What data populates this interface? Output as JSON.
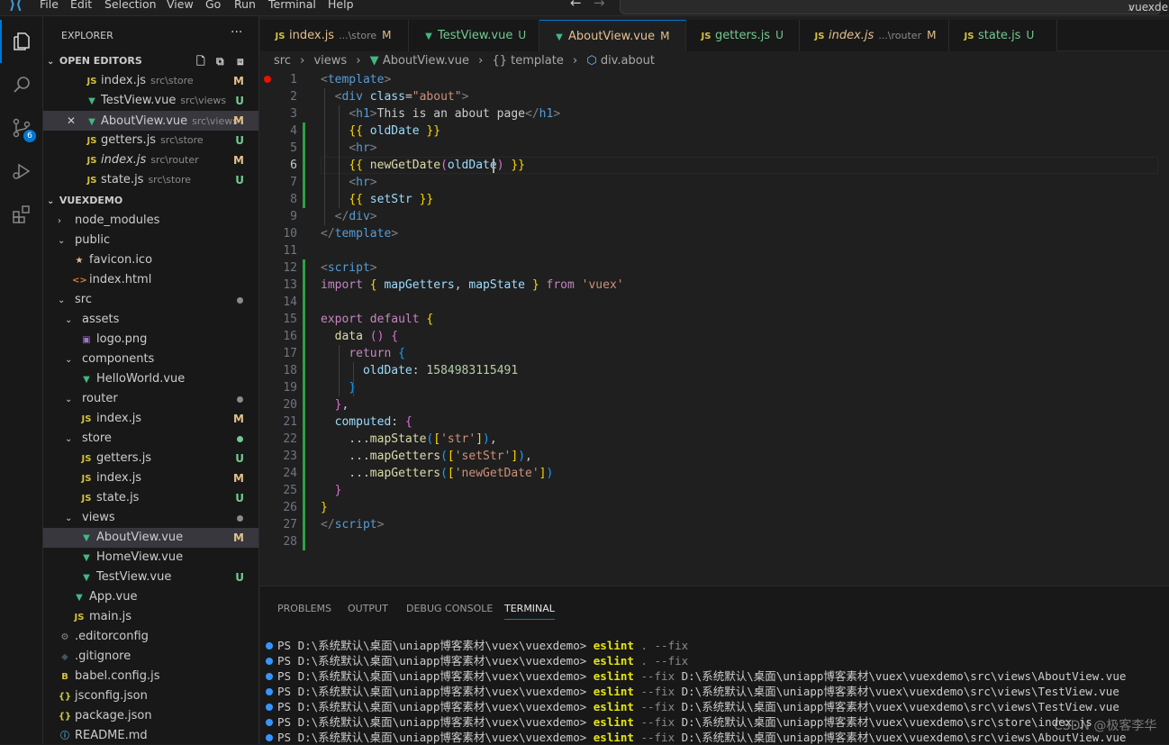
{
  "titlebar": {
    "menus": [
      "File",
      "Edit",
      "Selection",
      "View",
      "Go",
      "Run",
      "Terminal",
      "Help"
    ],
    "search_text": "vuexdemo"
  },
  "activity": {
    "scm_badge": "6"
  },
  "sidebar": {
    "title": "EXPLORER",
    "more": "···",
    "open_editors_label": "OPEN EDITORS",
    "open_editors": [
      {
        "icon": "JS",
        "name": "index.js",
        "path": "src\\store",
        "status": "M",
        "italic": false
      },
      {
        "icon": "V",
        "name": "TestView.vue",
        "path": "src\\views",
        "status": "U",
        "italic": false
      },
      {
        "icon": "V",
        "name": "AboutView.vue",
        "path": "src\\views",
        "status": "M",
        "italic": false,
        "close": "✕"
      },
      {
        "icon": "JS",
        "name": "getters.js",
        "path": "src\\store",
        "status": "U",
        "italic": false
      },
      {
        "icon": "JS",
        "name": "index.js",
        "path": "src\\router",
        "status": "M",
        "italic": true
      },
      {
        "icon": "JS",
        "name": "state.js",
        "path": "src\\store",
        "status": "U",
        "italic": false
      }
    ],
    "project_label": "VUEXDEMO",
    "tree": [
      {
        "name": "node_modules",
        "kind": "folder-closed",
        "depth": 0
      },
      {
        "name": "public",
        "kind": "folder-open",
        "depth": 0
      },
      {
        "name": "favicon.ico",
        "kind": "star",
        "depth": 1
      },
      {
        "name": "index.html",
        "kind": "html",
        "depth": 1
      },
      {
        "name": "src",
        "kind": "folder-open",
        "depth": 0,
        "dot": "#8b8b8b"
      },
      {
        "name": "assets",
        "kind": "folder-open",
        "depth": 1
      },
      {
        "name": "logo.png",
        "kind": "image",
        "depth": 2
      },
      {
        "name": "components",
        "kind": "folder-open",
        "depth": 1
      },
      {
        "name": "HelloWorld.vue",
        "kind": "vue",
        "depth": 2
      },
      {
        "name": "router",
        "kind": "folder-open",
        "depth": 1,
        "dot": "#8b8b8b"
      },
      {
        "name": "index.js",
        "kind": "js",
        "depth": 2,
        "status": "M"
      },
      {
        "name": "store",
        "kind": "folder-open",
        "depth": 1,
        "dot": "#73c991"
      },
      {
        "name": "getters.js",
        "kind": "js",
        "depth": 2,
        "status": "U"
      },
      {
        "name": "index.js",
        "kind": "js",
        "depth": 2,
        "status": "M"
      },
      {
        "name": "state.js",
        "kind": "js",
        "depth": 2,
        "status": "U"
      },
      {
        "name": "views",
        "kind": "folder-open",
        "depth": 1,
        "dot": "#8b8b8b"
      },
      {
        "name": "AboutView.vue",
        "kind": "vue",
        "depth": 2,
        "status": "M",
        "selected": true
      },
      {
        "name": "HomeView.vue",
        "kind": "vue",
        "depth": 2
      },
      {
        "name": "TestView.vue",
        "kind": "vue",
        "depth": 2,
        "status": "U"
      },
      {
        "name": "App.vue",
        "kind": "vue",
        "depth": 1
      },
      {
        "name": "main.js",
        "kind": "js",
        "depth": 1
      },
      {
        "name": ".editorconfig",
        "kind": "gear",
        "depth": 0
      },
      {
        "name": ".gitignore",
        "kind": "git",
        "depth": 0
      },
      {
        "name": "babel.config.js",
        "kind": "babel",
        "depth": 0
      },
      {
        "name": "jsconfig.json",
        "kind": "json",
        "depth": 0
      },
      {
        "name": "package.json",
        "kind": "json",
        "depth": 0
      },
      {
        "name": "README.md",
        "kind": "info",
        "depth": 0
      }
    ]
  },
  "tabs": [
    {
      "icon": "JS",
      "name": "index.js",
      "path": "...\\store",
      "status": "M",
      "italic": false
    },
    {
      "icon": "V",
      "name": "TestView.vue",
      "path": "",
      "status": "U",
      "italic": false
    },
    {
      "icon": "V",
      "name": "AboutView.vue",
      "path": "",
      "status": "M",
      "italic": false,
      "active": true
    },
    {
      "icon": "JS",
      "name": "getters.js",
      "path": "",
      "status": "U",
      "italic": false
    },
    {
      "icon": "JS",
      "name": "index.js",
      "path": "...\\router",
      "status": "M",
      "italic": true
    },
    {
      "icon": "JS",
      "name": "state.js",
      "path": "",
      "status": "U",
      "italic": false
    }
  ],
  "breadcrumb": {
    "p1": "src",
    "p2": "views",
    "p3": "AboutView.vue",
    "p4": "template",
    "p5": "div.about",
    "sep": "›"
  },
  "editor": {
    "line_numbers": [
      "1",
      "2",
      "3",
      "4",
      "5",
      "6",
      "7",
      "8",
      "9",
      "10",
      "11",
      "12",
      "13",
      "14",
      "15",
      "16",
      "17",
      "18",
      "19",
      "20",
      "21",
      "22",
      "23",
      "24",
      "25",
      "26",
      "27",
      "28"
    ],
    "current_line": 6,
    "lines": [
      [
        [
          "t-pun",
          "<"
        ],
        [
          "t-tag",
          "template"
        ],
        [
          "t-pun",
          ">"
        ]
      ],
      [
        [
          "",
          "  "
        ],
        [
          "t-pun",
          "<"
        ],
        [
          "t-tag",
          "div"
        ],
        [
          "",
          ""
        ],
        [
          "",
          " "
        ],
        [
          "t-att",
          "class"
        ],
        [
          "",
          "="
        ],
        [
          "t-str",
          "\"about\""
        ],
        [
          "t-pun",
          ">"
        ]
      ],
      [
        [
          "",
          "    "
        ],
        [
          "t-pun",
          "<"
        ],
        [
          "t-tag",
          "h1"
        ],
        [
          "t-pun",
          ">"
        ],
        [
          "",
          "This is an about page"
        ],
        [
          "t-pun",
          "</"
        ],
        [
          "t-tag",
          "h1"
        ],
        [
          "t-pun",
          ">"
        ]
      ],
      [
        [
          "",
          "    "
        ],
        [
          "t-br1",
          "{{"
        ],
        [
          "",
          " "
        ],
        [
          "t-var",
          "oldDate"
        ],
        [
          "",
          " "
        ],
        [
          "t-br1",
          "}}"
        ]
      ],
      [
        [
          "",
          "    "
        ],
        [
          "t-pun",
          "<"
        ],
        [
          "t-tag",
          "hr"
        ],
        [
          "t-pun",
          ">"
        ]
      ],
      [
        [
          "",
          "    "
        ],
        [
          "t-br1",
          "{{"
        ],
        [
          "",
          " "
        ],
        [
          "t-fn",
          "newGetDate"
        ],
        [
          "t-br2",
          "("
        ],
        [
          "t-var",
          "oldDate"
        ],
        [
          "t-br2",
          ")"
        ],
        [
          "",
          " "
        ],
        [
          "t-br1",
          "}}"
        ]
      ],
      [
        [
          "",
          "    "
        ],
        [
          "t-pun",
          "<"
        ],
        [
          "t-tag",
          "hr"
        ],
        [
          "t-pun",
          ">"
        ]
      ],
      [
        [
          "",
          "    "
        ],
        [
          "t-br1",
          "{{"
        ],
        [
          "",
          " "
        ],
        [
          "t-var",
          "setStr"
        ],
        [
          "",
          " "
        ],
        [
          "t-br1",
          "}}"
        ]
      ],
      [
        [
          "",
          "  "
        ],
        [
          "t-pun",
          "</"
        ],
        [
          "t-tag",
          "div"
        ],
        [
          "t-pun",
          ">"
        ]
      ],
      [
        [
          "t-pun",
          "</"
        ],
        [
          "t-tag",
          "template"
        ],
        [
          "t-pun",
          ">"
        ]
      ],
      [],
      [
        [
          "t-pun",
          "<"
        ],
        [
          "t-tag",
          "script"
        ],
        [
          "t-pun",
          ">"
        ]
      ],
      [
        [
          "t-kw",
          "import"
        ],
        [
          "",
          " "
        ],
        [
          "t-br1",
          "{"
        ],
        [
          "",
          " "
        ],
        [
          "t-var",
          "mapGetters"
        ],
        [
          "",
          ", "
        ],
        [
          "t-var",
          "mapState"
        ],
        [
          "",
          " "
        ],
        [
          "t-br1",
          "}"
        ],
        [
          "",
          " "
        ],
        [
          "t-kw",
          "from"
        ],
        [
          "",
          " "
        ],
        [
          "t-str",
          "'vuex'"
        ]
      ],
      [],
      [
        [
          "t-kw",
          "export"
        ],
        [
          "",
          " "
        ],
        [
          "t-kw",
          "default"
        ],
        [
          "",
          " "
        ],
        [
          "t-br1",
          "{"
        ]
      ],
      [
        [
          "",
          "  "
        ],
        [
          "t-fn",
          "data"
        ],
        [
          "",
          " "
        ],
        [
          "t-br2",
          "()"
        ],
        [
          "",
          " "
        ],
        [
          "t-br2",
          "{"
        ]
      ],
      [
        [
          "",
          "    "
        ],
        [
          "t-kw",
          "return"
        ],
        [
          "",
          " "
        ],
        [
          "t-br3",
          "{"
        ]
      ],
      [
        [
          "",
          "      "
        ],
        [
          "t-var",
          "oldDate"
        ],
        [
          "",
          ": "
        ],
        [
          "t-num",
          "1584983115491"
        ]
      ],
      [
        [
          "",
          "    "
        ],
        [
          "t-br3",
          "}"
        ]
      ],
      [
        [
          "",
          "  "
        ],
        [
          "t-br2",
          "}"
        ],
        [
          "",
          ","
        ]
      ],
      [
        [
          "",
          "  "
        ],
        [
          "t-var",
          "computed"
        ],
        [
          "",
          ": "
        ],
        [
          "t-br2",
          "{"
        ]
      ],
      [
        [
          "",
          "    ..."
        ],
        [
          "t-fn",
          "mapState"
        ],
        [
          "t-br3",
          "("
        ],
        [
          "t-br1",
          "["
        ],
        [
          "t-str",
          "'str'"
        ],
        [
          "t-br1",
          "]"
        ],
        [
          "t-br3",
          ")"
        ],
        [
          "",
          ","
        ]
      ],
      [
        [
          "",
          "    ..."
        ],
        [
          "t-fn",
          "mapGetters"
        ],
        [
          "t-br3",
          "("
        ],
        [
          "t-br1",
          "["
        ],
        [
          "t-str",
          "'setStr'"
        ],
        [
          "t-br1",
          "]"
        ],
        [
          "t-br3",
          ")"
        ],
        [
          "",
          ","
        ]
      ],
      [
        [
          "",
          "    ..."
        ],
        [
          "t-fn",
          "mapGetters"
        ],
        [
          "t-br3",
          "("
        ],
        [
          "t-br1",
          "["
        ],
        [
          "t-str",
          "'newGetDate'"
        ],
        [
          "t-br1",
          "]"
        ],
        [
          "t-br3",
          ")"
        ]
      ],
      [
        [
          "",
          "  "
        ],
        [
          "t-br2",
          "}"
        ]
      ],
      [
        [
          "t-br1",
          "}"
        ]
      ],
      [
        [
          "t-pun",
          "</"
        ],
        [
          "t-tag",
          "script"
        ],
        [
          "t-pun",
          ">"
        ]
      ],
      []
    ]
  },
  "panel": {
    "tabs": [
      "PROBLEMS",
      "OUTPUT",
      "DEBUG CONSOLE",
      "TERMINAL"
    ],
    "active_tab": "TERMINAL",
    "terminal_lines": [
      {
        "prompt": "PS D:\\系统默认\\桌面\\uniapp博客素材\\vuex\\vuexdemo> ",
        "cmd": "eslint",
        "args": " . --fix",
        "tail": ""
      },
      {
        "prompt": "PS D:\\系统默认\\桌面\\uniapp博客素材\\vuex\\vuexdemo> ",
        "cmd": "eslint",
        "args": " . --fix",
        "tail": ""
      },
      {
        "prompt": "PS D:\\系统默认\\桌面\\uniapp博客素材\\vuex\\vuexdemo> ",
        "cmd": "eslint",
        "args": " --fix ",
        "tail": "D:\\系统默认\\桌面\\uniapp博客素材\\vuex\\vuexdemo\\src\\views\\AboutView.vue"
      },
      {
        "prompt": "PS D:\\系统默认\\桌面\\uniapp博客素材\\vuex\\vuexdemo> ",
        "cmd": "eslint",
        "args": " --fix ",
        "tail": "D:\\系统默认\\桌面\\uniapp博客素材\\vuex\\vuexdemo\\src\\views\\TestView.vue"
      },
      {
        "prompt": "PS D:\\系统默认\\桌面\\uniapp博客素材\\vuex\\vuexdemo> ",
        "cmd": "eslint",
        "args": " --fix ",
        "tail": "D:\\系统默认\\桌面\\uniapp博客素材\\vuex\\vuexdemo\\src\\views\\TestView.vue"
      },
      {
        "prompt": "PS D:\\系统默认\\桌面\\uniapp博客素材\\vuex\\vuexdemo> ",
        "cmd": "eslint",
        "args": " --fix ",
        "tail": "D:\\系统默认\\桌面\\uniapp博客素材\\vuex\\vuexdemo\\src\\store\\index.js"
      },
      {
        "prompt": "PS D:\\系统默认\\桌面\\uniapp博客素材\\vuex\\vuexdemo> ",
        "cmd": "eslint",
        "args": " --fix ",
        "tail": "D:\\系统默认\\桌面\\uniapp博客素材\\vuex\\vuexdemo\\src\\views\\AboutView.vue"
      }
    ]
  },
  "watermark": "CSDN @极客李华",
  "colors": {
    "accent": "#0078d4",
    "modified": "#e2c08d",
    "untracked": "#73c991",
    "js": "#d6c23c",
    "vue": "#41b883"
  }
}
